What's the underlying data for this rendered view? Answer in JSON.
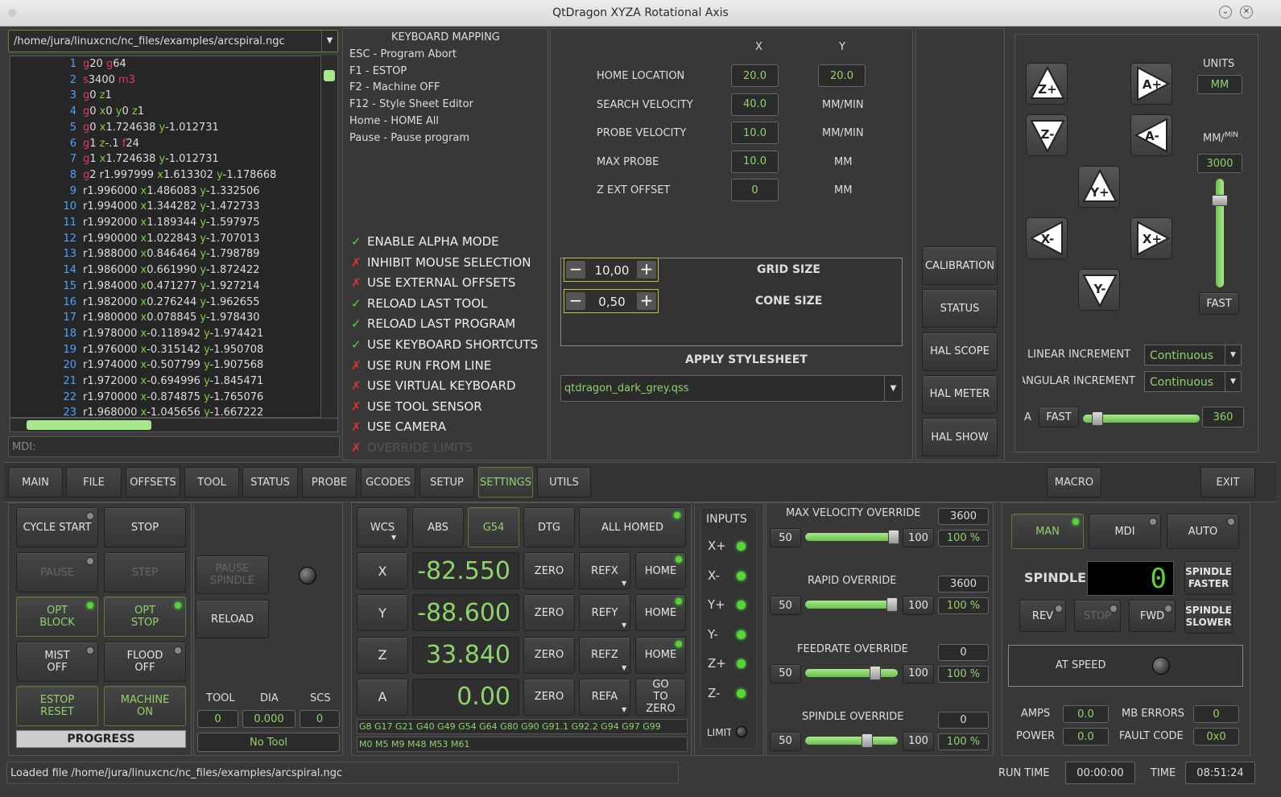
{
  "window": {
    "title": "QtDragon XYZA Rotational Axis"
  },
  "file": {
    "path": "/home/jura/linuxcnc/nc_files/examples/arcspiral.ngc"
  },
  "code_lines": [
    {
      "n": "1",
      "parts": [
        [
          "g",
          "r"
        ],
        [
          "20 ",
          ""
        ],
        [
          "g",
          "r"
        ],
        [
          "64",
          ""
        ]
      ]
    },
    {
      "n": "2",
      "parts": [
        [
          "s",
          "r"
        ],
        [
          "3400 ",
          ""
        ],
        [
          "m3",
          "r"
        ]
      ]
    },
    {
      "n": "3",
      "parts": [
        [
          "g",
          "r"
        ],
        [
          "0 ",
          ""
        ],
        [
          "z",
          "g"
        ],
        [
          "1",
          ""
        ]
      ]
    },
    {
      "n": "4",
      "parts": [
        [
          "g",
          "r"
        ],
        [
          "0 ",
          ""
        ],
        [
          "x",
          "g"
        ],
        [
          "0 ",
          ""
        ],
        [
          "y",
          "g"
        ],
        [
          "0 ",
          ""
        ],
        [
          "z",
          "g"
        ],
        [
          "1",
          ""
        ]
      ]
    },
    {
      "n": "5",
      "parts": [
        [
          "g",
          "r"
        ],
        [
          "0 ",
          ""
        ],
        [
          "x",
          "g"
        ],
        [
          "1.724638 ",
          ""
        ],
        [
          "y",
          "g"
        ],
        [
          "-1.012731",
          ""
        ]
      ]
    },
    {
      "n": "6",
      "parts": [
        [
          "g",
          "r"
        ],
        [
          "1 ",
          ""
        ],
        [
          "z",
          "g"
        ],
        [
          "-.1 ",
          ""
        ],
        [
          "f",
          "r"
        ],
        [
          "24",
          ""
        ]
      ]
    },
    {
      "n": "7",
      "parts": [
        [
          "g",
          "r"
        ],
        [
          "1 ",
          ""
        ],
        [
          "x",
          "g"
        ],
        [
          "1.724638 ",
          ""
        ],
        [
          "y",
          "g"
        ],
        [
          "-1.012731",
          ""
        ]
      ]
    },
    {
      "n": "8",
      "parts": [
        [
          "g",
          "r"
        ],
        [
          "2 r1.997999 ",
          ""
        ],
        [
          "x",
          "g"
        ],
        [
          "1.613302 ",
          ""
        ],
        [
          "y",
          "g"
        ],
        [
          "-1.178668",
          ""
        ]
      ]
    },
    {
      "n": "9",
      "parts": [
        [
          "r1.996000 ",
          ""
        ],
        [
          "x",
          "g"
        ],
        [
          "1.486083 ",
          ""
        ],
        [
          "y",
          "g"
        ],
        [
          "-1.332506",
          ""
        ]
      ]
    },
    {
      "n": "10",
      "parts": [
        [
          "r1.994000 ",
          ""
        ],
        [
          "x",
          "g"
        ],
        [
          "1.344282 ",
          ""
        ],
        [
          "y",
          "g"
        ],
        [
          "-1.472733",
          ""
        ]
      ]
    },
    {
      "n": "11",
      "parts": [
        [
          "r1.992000 ",
          ""
        ],
        [
          "x",
          "g"
        ],
        [
          "1.189344 ",
          ""
        ],
        [
          "y",
          "g"
        ],
        [
          "-1.597975",
          ""
        ]
      ]
    },
    {
      "n": "12",
      "parts": [
        [
          "r1.990000 ",
          ""
        ],
        [
          "x",
          "g"
        ],
        [
          "1.022843 ",
          ""
        ],
        [
          "y",
          "g"
        ],
        [
          "-1.707013",
          ""
        ]
      ]
    },
    {
      "n": "13",
      "parts": [
        [
          "r1.988000 ",
          ""
        ],
        [
          "x",
          "g"
        ],
        [
          "0.846464 ",
          ""
        ],
        [
          "y",
          "g"
        ],
        [
          "-1.798789",
          ""
        ]
      ]
    },
    {
      "n": "14",
      "parts": [
        [
          "r1.986000 ",
          ""
        ],
        [
          "x",
          "g"
        ],
        [
          "0.661990 ",
          ""
        ],
        [
          "y",
          "g"
        ],
        [
          "-1.872422",
          ""
        ]
      ]
    },
    {
      "n": "15",
      "parts": [
        [
          "r1.984000 ",
          ""
        ],
        [
          "x",
          "g"
        ],
        [
          "0.471277 ",
          ""
        ],
        [
          "y",
          "g"
        ],
        [
          "-1.927214",
          ""
        ]
      ]
    },
    {
      "n": "16",
      "parts": [
        [
          "r1.982000 ",
          ""
        ],
        [
          "x",
          "g"
        ],
        [
          "0.276244 ",
          ""
        ],
        [
          "y",
          "g"
        ],
        [
          "-1.962655",
          ""
        ]
      ]
    },
    {
      "n": "17",
      "parts": [
        [
          "r1.980000 ",
          ""
        ],
        [
          "x",
          "g"
        ],
        [
          "0.078845 ",
          ""
        ],
        [
          "y",
          "g"
        ],
        [
          "-1.978430",
          ""
        ]
      ]
    },
    {
      "n": "18",
      "parts": [
        [
          "r1.978000 ",
          ""
        ],
        [
          "x",
          "g"
        ],
        [
          "-0.118942 ",
          ""
        ],
        [
          "y",
          "g"
        ],
        [
          "-1.974421",
          ""
        ]
      ]
    },
    {
      "n": "19",
      "parts": [
        [
          "r1.976000 ",
          ""
        ],
        [
          "x",
          "g"
        ],
        [
          "-0.315142 ",
          ""
        ],
        [
          "y",
          "g"
        ],
        [
          "-1.950708",
          ""
        ]
      ]
    },
    {
      "n": "20",
      "parts": [
        [
          "r1.974000 ",
          ""
        ],
        [
          "x",
          "g"
        ],
        [
          "-0.507799 ",
          ""
        ],
        [
          "y",
          "g"
        ],
        [
          "-1.907568",
          ""
        ]
      ]
    },
    {
      "n": "21",
      "parts": [
        [
          "r1.972000 ",
          ""
        ],
        [
          "x",
          "g"
        ],
        [
          "-0.694996 ",
          ""
        ],
        [
          "y",
          "g"
        ],
        [
          "-1.845471",
          ""
        ]
      ]
    },
    {
      "n": "22",
      "parts": [
        [
          "r1.970000 ",
          ""
        ],
        [
          "x",
          "g"
        ],
        [
          "-0.874875 ",
          ""
        ],
        [
          "y",
          "g"
        ],
        [
          "-1.765076",
          ""
        ]
      ]
    },
    {
      "n": "23",
      "parts": [
        [
          "r1.968000 ",
          ""
        ],
        [
          "x",
          "g"
        ],
        [
          "-1.045656 ",
          ""
        ],
        [
          "y",
          "g"
        ],
        [
          "-1.667222",
          ""
        ]
      ]
    }
  ],
  "mdi": {
    "label": "MDI:"
  },
  "keyboard": {
    "title": "KEYBOARD MAPPING",
    "items": [
      "ESC - Program Abort",
      "F1 - ESTOP",
      "F2 - Machine OFF",
      "F12 - Style Sheet Editor",
      "Home - HOME All",
      "Pause - Pause program"
    ]
  },
  "options": [
    {
      "label": "ENABLE ALPHA MODE",
      "checked": true
    },
    {
      "label": "INHIBIT MOUSE SELECTION",
      "checked": false
    },
    {
      "label": "USE EXTERNAL OFFSETS",
      "checked": false
    },
    {
      "label": "RELOAD LAST TOOL",
      "checked": true
    },
    {
      "label": "RELOAD LAST PROGRAM",
      "checked": true
    },
    {
      "label": "USE KEYBOARD SHORTCUTS",
      "checked": true
    },
    {
      "label": "USE RUN FROM LINE",
      "checked": false
    },
    {
      "label": "USE VIRTUAL KEYBOARD",
      "checked": false
    },
    {
      "label": "USE TOOL SENSOR",
      "checked": false
    },
    {
      "label": "USE CAMERA",
      "checked": false
    },
    {
      "label": "OVERRIDE LIMITS",
      "checked": false
    }
  ],
  "probe": {
    "col_x": "X",
    "col_y": "Y",
    "rows": [
      {
        "label": "HOME LOCATION",
        "x": "20.0",
        "y": "20.0",
        "unit": ""
      },
      {
        "label": "SEARCH VELOCITY",
        "x": "40.0",
        "y": "",
        "unit": "MM/MIN"
      },
      {
        "label": "PROBE VELOCITY",
        "x": "10.0",
        "y": "",
        "unit": "MM/MIN"
      },
      {
        "label": "MAX PROBE",
        "x": "10.0",
        "y": "",
        "unit": "MM"
      },
      {
        "label": "Z EXT OFFSET",
        "x": "0",
        "y": "",
        "unit": "MM"
      }
    ]
  },
  "grid": {
    "value": "10,00",
    "label": "GRID SIZE"
  },
  "cone": {
    "value": "0,50",
    "label": "CONE SIZE"
  },
  "stylesheet": {
    "title": "APPLY STYLESHEET",
    "value": "qtdragon_dark_grey.qss"
  },
  "side_buttons": [
    "CALIBRATION",
    "STATUS",
    "HAL SCOPE",
    "HAL METER",
    "HAL SHOW"
  ],
  "jog": {
    "z_plus": "Z+",
    "z_minus": "Z-",
    "a_plus": "A+",
    "a_minus": "A-",
    "y_plus": "Y+",
    "y_minus": "Y-",
    "x_minus": "X-",
    "x_plus": "X+",
    "units_label": "UNITS",
    "units_value": "MM",
    "rate_label_main": "MM/",
    "rate_label_sup": "MIN",
    "rate_value": "3000",
    "fast": "FAST",
    "linear_label": "LINEAR INCREMENT",
    "linear_value": "Continuous",
    "angular_label": "ANGULAR INCREMENT",
    "angular_value": "Continuous",
    "a_label": "A",
    "a_fast": "FAST",
    "a_value": "360"
  },
  "tabs": [
    "MAIN",
    "FILE",
    "OFFSETS",
    "TOOL",
    "STATUS",
    "PROBE",
    "GCODES",
    "SETUP",
    "SETTINGS",
    "UTILS"
  ],
  "macro": "MACRO",
  "exit": "EXIT",
  "control": {
    "cycle_start": "CYCLE START",
    "stop": "STOP",
    "pause": "PAUSE",
    "step": "STEP",
    "opt_block": "OPT BLOCK",
    "opt_stop": "OPT STOP",
    "mist": "MIST OFF",
    "flood": "FLOOD OFF",
    "estop": "ESTOP RESET",
    "machine": "MACHINE ON",
    "progress": "PROGRESS"
  },
  "spindle_mid": {
    "pause": "PAUSE SPINDLE",
    "reload": "RELOAD",
    "tool": "TOOL",
    "dia": "DIA",
    "scs": "SCS",
    "tool_v": "0",
    "dia_v": "0.000",
    "scs_v": "0",
    "no_tool": "No Tool"
  },
  "dro": {
    "wcs": "WCS",
    "abs": "ABS",
    "g54": "G54",
    "dtg": "DTG",
    "homed": "ALL HOMED",
    "axes": [
      {
        "name": "X",
        "value": "-82.550",
        "ref": "REFX",
        "home": "HOME"
      },
      {
        "name": "Y",
        "value": "-88.600",
        "ref": "REFY",
        "home": "HOME"
      },
      {
        "name": "Z",
        "value": "33.840",
        "ref": "REFZ",
        "home": "HOME"
      },
      {
        "name": "A",
        "value": "0.00",
        "ref": "REFA",
        "home": "GO TO ZERO"
      }
    ],
    "zero": "ZERO",
    "gcodes": "G8 G17 G21 G40 G49 G54 G64 G80 G90 G91.1 G92.2 G94 G97 G99",
    "mcodes": "M0 M5 M9 M48 M53 M61"
  },
  "inputs": {
    "title": "INPUTS",
    "items": [
      "X+",
      "X-",
      "Y+",
      "Y-",
      "Z+",
      "Z-"
    ],
    "limit": "LIMIT"
  },
  "overrides": [
    {
      "title": "MAX VELOCITY OVERRIDE",
      "value": "3600",
      "min": "50",
      "max": "100",
      "pct": "100 %",
      "pos": 1.0
    },
    {
      "title": "RAPID OVERRIDE",
      "value": "3600",
      "min": "50",
      "max": "100",
      "pct": "100 %",
      "pos": 0.98
    },
    {
      "title": "FEEDRATE OVERRIDE",
      "value": "0",
      "min": "50",
      "max": "100",
      "pct": "100 %",
      "pos": 0.78
    },
    {
      "title": "SPINDLE OVERRIDE",
      "value": "0",
      "min": "50",
      "max": "100",
      "pct": "100 %",
      "pos": 0.68
    }
  ],
  "modes": {
    "man": "MAN",
    "mdi": "MDI",
    "auto": "AUTO"
  },
  "spindle": {
    "label": "SPINDLE",
    "rpm": "0",
    "faster": "SPINDLE FASTER",
    "slower": "SPINDLE SLOWER",
    "rev": "REV",
    "stop": "STOP",
    "fwd": "FWD",
    "at_speed": "AT SPEED",
    "amps_label": "AMPS",
    "amps": "0.0",
    "power_label": "POWER",
    "power": "0.0",
    "mb_label": "MB ERRORS",
    "mb": "0",
    "fault_label": "FAULT CODE",
    "fault": "0x0"
  },
  "status": {
    "message": "Loaded file /home/jura/linuxcnc/nc_files/examples/arcspiral.ngc",
    "run_label": "RUN TIME",
    "run": "00:00:00",
    "time_label": "TIME",
    "time": "08:51:24"
  }
}
